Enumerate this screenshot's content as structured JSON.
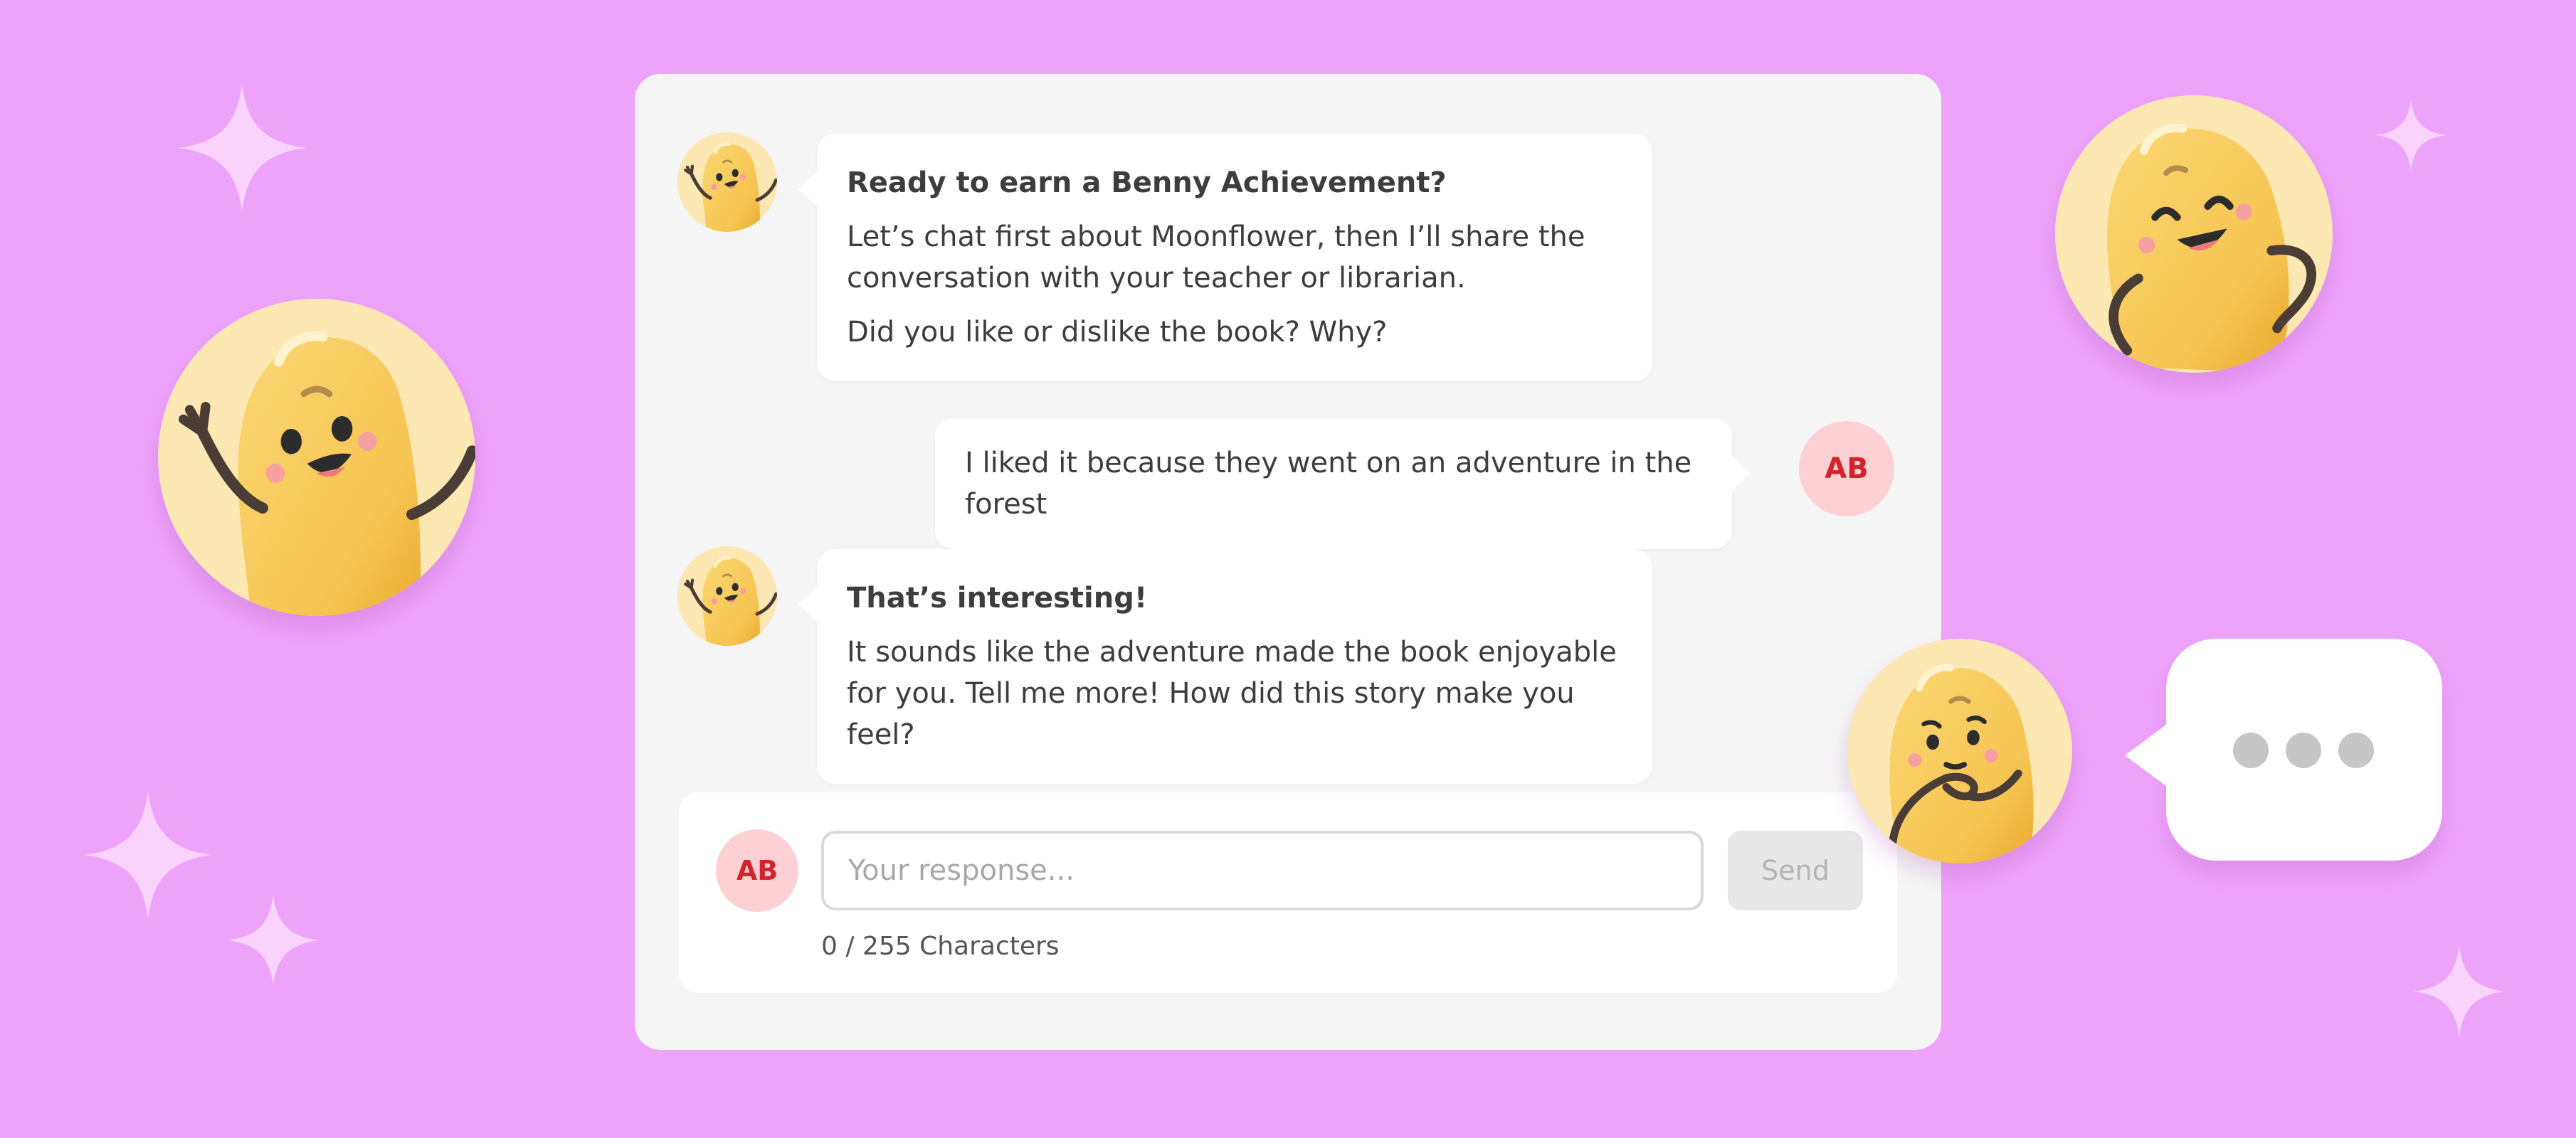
{
  "chat": {
    "messages": [
      {
        "sender": "bot",
        "title": "Ready to earn a Benny Achievement?",
        "paragraphs": [
          "Let’s chat first about Moonflower, then I’ll share the conversation with your teacher or librarian.",
          "Did you like or dislike the book? Why?"
        ]
      },
      {
        "sender": "user",
        "text": "I liked it because they went on an adventure in the forest",
        "initials": "AB"
      },
      {
        "sender": "bot",
        "title": "That’s interesting!",
        "paragraphs": [
          "It sounds like the adventure made the book enjoyable for you. Tell me more! How did this story make you feel?"
        ]
      }
    ]
  },
  "composer": {
    "user_initials": "AB",
    "placeholder": "Your response...",
    "value": "",
    "send_label": "Send",
    "char_count": "0 / 255 Characters"
  },
  "icons": {
    "bot_avatar": "bean-mascot-icon",
    "typing_indicator": "typing-dots-icon",
    "sparkle": "sparkle-icon"
  },
  "colors": {
    "background": "#eea3fb",
    "panel": "#f5f5f5",
    "user_avatar_bg": "#fdd1d4",
    "user_avatar_text": "#d3242e",
    "mascot_bg": "#fde7b3",
    "mascot_body": "#f9ce61"
  }
}
